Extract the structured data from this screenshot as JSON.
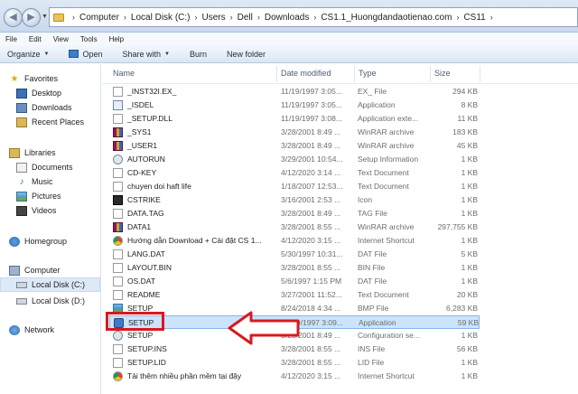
{
  "address_bar": {
    "crumbs": [
      "Computer",
      "Local Disk (C:)",
      "Users",
      "Dell",
      "Downloads",
      "CS1.1_Huongdandaotienao.com",
      "CS11"
    ],
    "separator": "›"
  },
  "menu": [
    "File",
    "Edit",
    "View",
    "Tools",
    "Help"
  ],
  "toolbar": {
    "organize": "Organize",
    "open": "Open",
    "share_with": "Share with",
    "burn": "Burn",
    "new_folder": "New folder"
  },
  "nav": {
    "favorites": "Favorites",
    "desktop": "Desktop",
    "downloads": "Downloads",
    "recent_places": "Recent Places",
    "libraries": "Libraries",
    "documents": "Documents",
    "music": "Music",
    "pictures": "Pictures",
    "videos": "Videos",
    "homegroup": "Homegroup",
    "computer": "Computer",
    "local_c": "Local Disk (C:)",
    "local_d": "Local Disk (D:)",
    "network": "Network"
  },
  "columns": {
    "name": "Name",
    "date": "Date modified",
    "type": "Type",
    "size": "Size"
  },
  "files": [
    {
      "name": "_INST32I.EX_",
      "date": "11/19/1997 3:05...",
      "type": "EX_ File",
      "size": "294 KB",
      "icon": "doc"
    },
    {
      "name": "_ISDEL",
      "date": "11/19/1997 3:05...",
      "type": "Application",
      "size": "8 KB",
      "icon": "app"
    },
    {
      "name": "_SETUP.DLL",
      "date": "11/19/1997 3:08...",
      "type": "Application exte...",
      "size": "11 KB",
      "icon": "doc"
    },
    {
      "name": "_SYS1",
      "date": "3/28/2001 8:49 ...",
      "type": "WinRAR archive",
      "size": "183 KB",
      "icon": "rar"
    },
    {
      "name": "_USER1",
      "date": "3/28/2001 8:49 ...",
      "type": "WinRAR archive",
      "size": "45 KB",
      "icon": "rar"
    },
    {
      "name": "AUTORUN",
      "date": "3/29/2001 10:54...",
      "type": "Setup Information",
      "size": "1 KB",
      "icon": "gear"
    },
    {
      "name": "CD-KEY",
      "date": "4/12/2020 3:14 ...",
      "type": "Text Document",
      "size": "1 KB",
      "icon": "txt"
    },
    {
      "name": "chuyen doi haft life",
      "date": "1/18/2007 12:53...",
      "type": "Text Document",
      "size": "1 KB",
      "icon": "txt"
    },
    {
      "name": "CSTRIKE",
      "date": "3/16/2001 2:53 ...",
      "type": "Icon",
      "size": "1 KB",
      "icon": "cs"
    },
    {
      "name": "DATA.TAG",
      "date": "3/28/2001 8:49 ...",
      "type": "TAG File",
      "size": "1 KB",
      "icon": "doc"
    },
    {
      "name": "DATA1",
      "date": "3/28/2001 8:55 ...",
      "type": "WinRAR archive",
      "size": "297,755 KB",
      "icon": "rar"
    },
    {
      "name": "Hướng dẫn Download + Cài đặt CS 1...",
      "date": "4/12/2020 3:15 ...",
      "type": "Internet Shortcut",
      "size": "1 KB",
      "icon": "chrome"
    },
    {
      "name": "LANG.DAT",
      "date": "5/30/1997 10:31...",
      "type": "DAT File",
      "size": "5 KB",
      "icon": "doc"
    },
    {
      "name": "LAYOUT.BIN",
      "date": "3/28/2001 8:55 ...",
      "type": "BIN File",
      "size": "1 KB",
      "icon": "doc"
    },
    {
      "name": "OS.DAT",
      "date": "5/6/1997 1:15 PM",
      "type": "DAT File",
      "size": "1 KB",
      "icon": "doc"
    },
    {
      "name": "README",
      "date": "3/27/2001 11:52...",
      "type": "Text Document",
      "size": "20 KB",
      "icon": "txt"
    },
    {
      "name": "SETUP",
      "date": "8/24/2018 4:34 ...",
      "type": "BMP File",
      "size": "6,283 KB",
      "icon": "bmp"
    },
    {
      "name": "SETUP",
      "date": "11/19/1997 3:09...",
      "type": "Application",
      "size": "59 KB",
      "icon": "setup",
      "selected": true
    },
    {
      "name": "SETUP",
      "date": "3/28/2001 8:49 ...",
      "type": "Configuration se...",
      "size": "1 KB",
      "icon": "gear"
    },
    {
      "name": "SETUP.INS",
      "date": "3/28/2001 8:55 ...",
      "type": "INS File",
      "size": "56 KB",
      "icon": "doc"
    },
    {
      "name": "SETUP.LID",
      "date": "3/28/2001 8:55 ...",
      "type": "LID File",
      "size": "1 KB",
      "icon": "doc"
    },
    {
      "name": "Tải thêm nhiều phần mềm tại đây",
      "date": "4/12/2020 3:15 ...",
      "type": "Internet Shortcut",
      "size": "1 KB",
      "icon": "chrome"
    }
  ],
  "colors": {
    "highlight_red": "#d71920",
    "selection_bg": "#cce4fb"
  }
}
